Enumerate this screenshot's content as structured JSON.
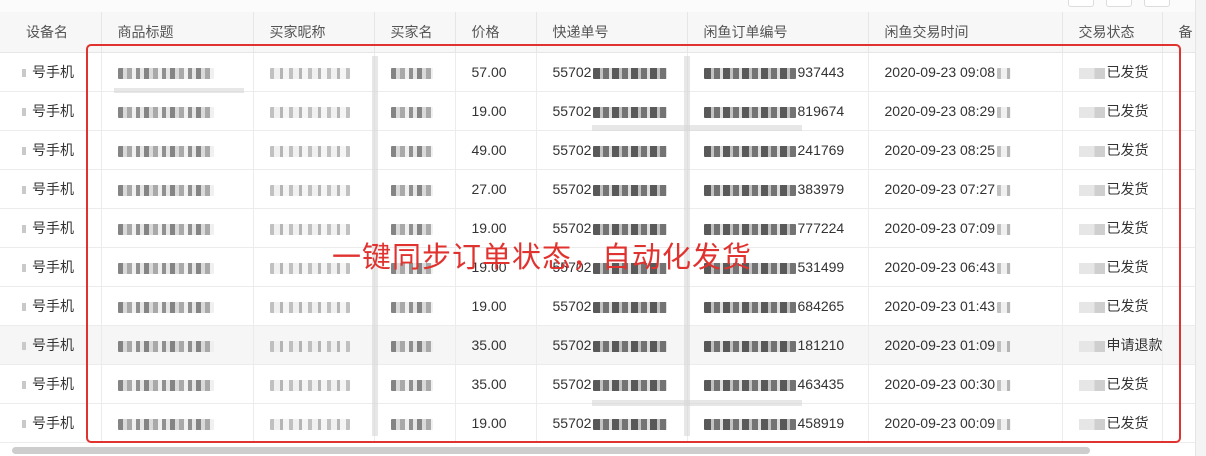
{
  "columns": {
    "device": "设备名",
    "title": "商品标题",
    "nickname": "买家昵称",
    "buyer": "买家名",
    "price": "价格",
    "express": "快递单号",
    "order": "闲鱼订单编号",
    "time": "闲鱼交易时间",
    "status": "交易状态",
    "extra": "备"
  },
  "rows": [
    {
      "device": "号手机",
      "price": "57.00",
      "express": "55702",
      "order": "937443",
      "time": "2020-09-23 09:08",
      "status": "已发货"
    },
    {
      "device": "号手机",
      "price": "19.00",
      "express": "55702",
      "order": "819674",
      "time": "2020-09-23 08:29",
      "status": "已发货"
    },
    {
      "device": "号手机",
      "price": "49.00",
      "express": "55702",
      "order": "241769",
      "time": "2020-09-23 08:25",
      "status": "已发货"
    },
    {
      "device": "号手机",
      "price": "27.00",
      "express": "55702",
      "order": "383979",
      "time": "2020-09-23 07:27",
      "status": "已发货"
    },
    {
      "device": "号手机",
      "price": "19.00",
      "express": "55702",
      "order": "777224",
      "time": "2020-09-23 07:09",
      "status": "已发货"
    },
    {
      "device": "号手机",
      "price": "19.00",
      "express": "55702",
      "order": "531499",
      "time": "2020-09-23 06:43",
      "status": "已发货"
    },
    {
      "device": "号手机",
      "price": "19.00",
      "express": "55702",
      "order": "684265",
      "time": "2020-09-23 01:43",
      "status": "已发货"
    },
    {
      "device": "号手机",
      "price": "35.00",
      "express": "55702",
      "order": "181210",
      "time": "2020-09-23 01:09",
      "status": "申请退款"
    },
    {
      "device": "号手机",
      "price": "35.00",
      "express": "55702",
      "order": "463435",
      "time": "2020-09-23 00:30",
      "status": "已发货"
    },
    {
      "device": "号手机",
      "price": "19.00",
      "express": "55702",
      "order": "458919",
      "time": "2020-09-23 00:09",
      "status": "已发货"
    }
  ],
  "highlight_row_index": 7,
  "overlay": {
    "text": "一键同步订单状态，自动化发货",
    "color": "#e0322e"
  }
}
